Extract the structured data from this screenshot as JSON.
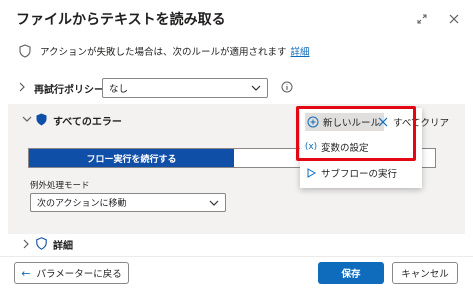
{
  "dialog": {
    "title": "ファイルからテキストを読み取る"
  },
  "info": {
    "text": "アクションが失敗した場合は、次のルールが適用されます",
    "link": "詳細"
  },
  "retry": {
    "label": "再試行ポリシー",
    "value": "なし"
  },
  "errors": {
    "label": "すべてのエラー",
    "tab_active": "フロー実行を続行する",
    "mode_label": "例外処理モード",
    "mode_value": "次のアクションに移動"
  },
  "menu": {
    "new_rule": "新しいルール",
    "clear_all": "すべてクリア",
    "set_variable": "変数の設定",
    "run_subflow": "サブフローの実行"
  },
  "details": {
    "label": "詳細"
  },
  "footer": {
    "back": "パラメーターに戻る",
    "save": "保存",
    "cancel": "キャンセル"
  },
  "colors": {
    "accent": "#0f6cbd",
    "tab_active_bg": "#0f4fa8",
    "highlight": "#e30613",
    "panel_bg": "#f3f2f1"
  }
}
